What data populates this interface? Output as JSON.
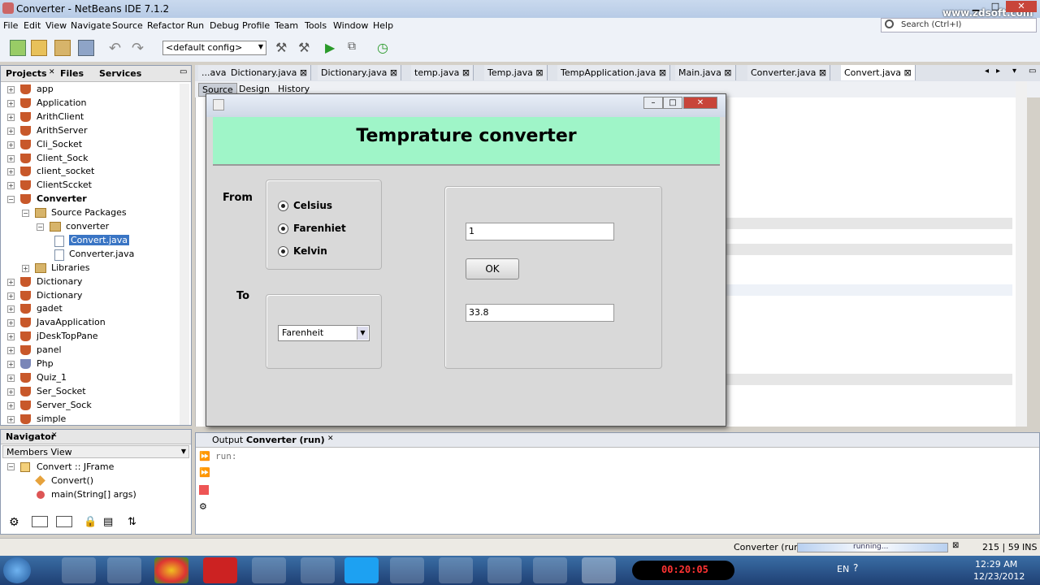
{
  "window": {
    "title": "Converter - NetBeans IDE 7.1.2",
    "watermark": "www.zdsoft.com"
  },
  "menu": [
    "File",
    "Edit",
    "View",
    "Navigate",
    "Source",
    "Refactor",
    "Run",
    "Debug",
    "Profile",
    "Team",
    "Tools",
    "Window",
    "Help"
  ],
  "search": {
    "placeholder": "Search (Ctrl+I)"
  },
  "toolbar": {
    "config": "<default config>"
  },
  "projects": {
    "tabs": [
      "Projects",
      "Files",
      "Services"
    ],
    "items": [
      "app",
      "Application",
      "ArithClient",
      "ArithServer",
      "Cli_Socket",
      "Client_Sock",
      "client_socket",
      "ClientSccket",
      "Converter",
      "Source Packages",
      "converter",
      "Convert.java",
      "Converter.java",
      "Libraries",
      "Dictionary",
      "Dictionary",
      "gadet",
      "JavaApplication",
      "jDeskTopPane",
      "panel",
      "Php",
      "Quiz_1",
      "Ser_Socket",
      "Server_Sock",
      "simple"
    ]
  },
  "navigator": {
    "title": "Navigator",
    "view": "Members View",
    "root": "Convert :: JFrame",
    "members": [
      "Convert()",
      "main(String[] args)"
    ]
  },
  "editor": {
    "tabs": [
      "...ava",
      "Dictionary.java",
      "Dictionary.java",
      "temp.java",
      "Temp.java",
      "TempApplication.java",
      "Main.java",
      "Converter.java",
      "Convert.java"
    ],
    "modes": [
      "Source",
      "Design",
      "History"
    ]
  },
  "output": {
    "title_prefix": "Output - ",
    "title": "Converter (run)",
    "text": "run:"
  },
  "status": {
    "task": "Converter (run)",
    "progress": "running...",
    "position": "215 | 59",
    "mode": "INS"
  },
  "clock": {
    "time": "12:29 AM",
    "date": "12/23/2012",
    "lang": "EN"
  },
  "recorder": "00:20:05",
  "dialog": {
    "heading": "Temprature converter",
    "from_label": "From",
    "to_label": "To",
    "options": [
      "Celsius",
      "Farenhiet",
      "Kelvin"
    ],
    "to_selected": "Farenheit",
    "input_value": "1",
    "ok_label": "OK",
    "result_value": "33.8"
  }
}
